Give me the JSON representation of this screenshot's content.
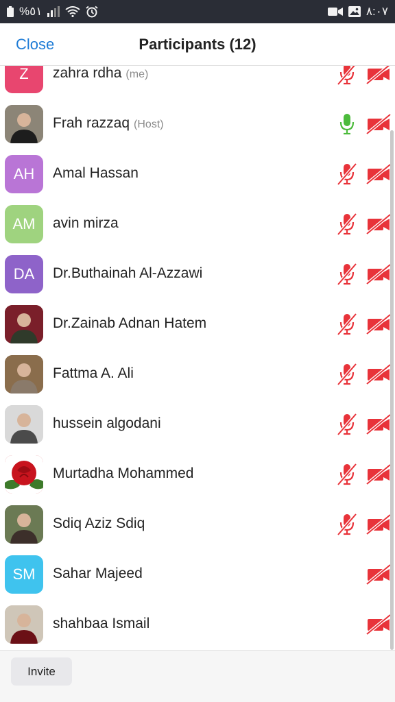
{
  "status_bar": {
    "battery_percent": "%٥١",
    "time": "٨:٠٧",
    "icons_left": [
      "battery-icon",
      "signal-icon",
      "wifi-icon",
      "alarm-icon"
    ],
    "icons_right": [
      "video-recording-icon",
      "gallery-icon"
    ]
  },
  "header": {
    "close_label": "Close",
    "title": "Participants (12)"
  },
  "participants": [
    {
      "name": "zahra rdha",
      "tag": "(me)",
      "initials": "Z",
      "avatar_color": "#e8466f",
      "avatar_type": "initials",
      "mic": "muted",
      "camera": "off"
    },
    {
      "name": "Frah razzaq",
      "tag": "(Host)",
      "initials": "",
      "avatar_color": "#8c8577",
      "avatar_type": "photo",
      "mic": "on",
      "camera": "off"
    },
    {
      "name": "Amal Hassan",
      "tag": "",
      "initials": "AH",
      "avatar_color": "#b975d6",
      "avatar_type": "initials",
      "mic": "muted",
      "camera": "off"
    },
    {
      "name": "avin mirza",
      "tag": "",
      "initials": "AM",
      "avatar_color": "#9fd37f",
      "avatar_type": "initials",
      "mic": "muted",
      "camera": "off"
    },
    {
      "name": "Dr.Buthainah Al-Azzawi",
      "tag": "",
      "initials": "DA",
      "avatar_color": "#8e63c9",
      "avatar_type": "initials",
      "mic": "muted",
      "camera": "off"
    },
    {
      "name": "Dr.Zainab Adnan Hatem",
      "tag": "",
      "initials": "",
      "avatar_color": "#7a1f2a",
      "avatar_type": "photo",
      "mic": "muted",
      "camera": "off"
    },
    {
      "name": "Fattma A. Ali",
      "tag": "",
      "initials": "",
      "avatar_color": "#8a6d4c",
      "avatar_type": "photo",
      "mic": "muted",
      "camera": "off"
    },
    {
      "name": "hussein algodani",
      "tag": "",
      "initials": "",
      "avatar_color": "#d9d9d9",
      "avatar_type": "photo",
      "mic": "muted",
      "camera": "off"
    },
    {
      "name": "Murtadha Mohammed",
      "tag": "",
      "initials": "",
      "avatar_color": "#c8141e",
      "avatar_type": "photo",
      "mic": "muted",
      "camera": "off"
    },
    {
      "name": "Sdiq Aziz Sdiq",
      "tag": "",
      "initials": "",
      "avatar_color": "#6b7a54",
      "avatar_type": "photo",
      "mic": "muted",
      "camera": "off"
    },
    {
      "name": "Sahar Majeed",
      "tag": "",
      "initials": "SM",
      "avatar_color": "#3fc3ee",
      "avatar_type": "initials",
      "mic": "none",
      "camera": "off"
    },
    {
      "name": "shahbaa Ismail",
      "tag": "",
      "initials": "",
      "avatar_color": "#cfc6b8",
      "avatar_type": "photo",
      "mic": "none",
      "camera": "off"
    }
  ],
  "footer": {
    "invite_label": "Invite"
  },
  "colors": {
    "accent": "#1f7cd6",
    "muted_red": "#e8333a",
    "mic_on_green": "#4cbb3c",
    "status_bar_bg": "#2a2d36"
  }
}
